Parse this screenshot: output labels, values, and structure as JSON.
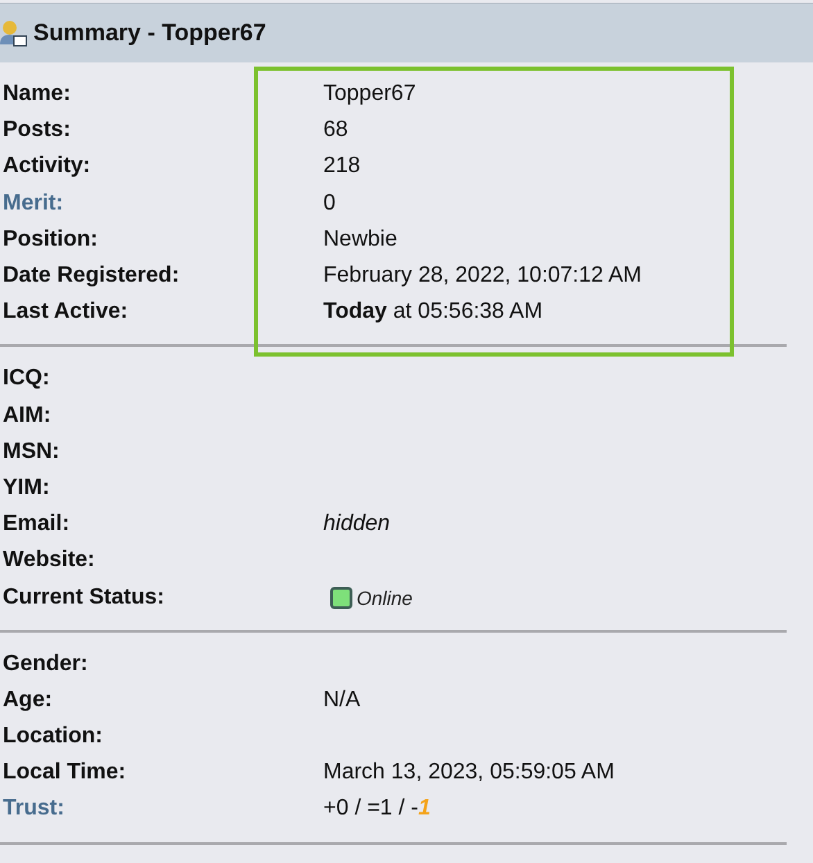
{
  "header": {
    "title": "Summary - Topper67"
  },
  "sections": [
    {
      "highlighted": true,
      "rows": [
        {
          "label": "Name:",
          "link": false,
          "value": "Topper67",
          "kind": "plain"
        },
        {
          "label": "Posts:",
          "link": false,
          "value": "68",
          "kind": "plain"
        },
        {
          "label": "Activity:",
          "link": false,
          "value": "218",
          "kind": "plain"
        },
        {
          "label": "Merit:",
          "link": true,
          "value": "0",
          "kind": "plain"
        },
        {
          "label": "Position:",
          "link": false,
          "value": "Newbie",
          "kind": "plain"
        },
        {
          "label": "Date Registered:",
          "link": false,
          "value": "February 28, 2022, 10:07:12 AM",
          "kind": "plain"
        },
        {
          "label": "Last Active:",
          "link": false,
          "value": "**Today** at 05:56:38 AM",
          "kind": "plain"
        }
      ]
    },
    {
      "rows": [
        {
          "label": "ICQ:",
          "link": false
        },
        {
          "label": "AIM:",
          "link": false
        },
        {
          "label": "MSN:",
          "link": false
        },
        {
          "label": "YIM:",
          "link": false
        },
        {
          "label": "Email:",
          "link": false,
          "value": "hidden",
          "kind": "italic"
        },
        {
          "label": "Website:",
          "link": false
        },
        {
          "label": "Current Status:",
          "link": false,
          "value": "Online",
          "kind": "status",
          "online": true
        }
      ]
    },
    {
      "rows": [
        {
          "label": "Gender:",
          "link": false
        },
        {
          "label": "Age:",
          "link": false,
          "value": "N/A",
          "kind": "plain"
        },
        {
          "label": "Location:",
          "link": false
        },
        {
          "label": "Local Time:",
          "link": false,
          "value": "March 13, 2023, 05:59:05 AM",
          "kind": "plain"
        },
        {
          "label": "Trust:",
          "link": true,
          "kind": "trust",
          "parts": [
            {
              "text": "+0 / =1 / -",
              "negative": false
            },
            {
              "text": "1",
              "negative": true
            }
          ]
        }
      ]
    }
  ]
}
